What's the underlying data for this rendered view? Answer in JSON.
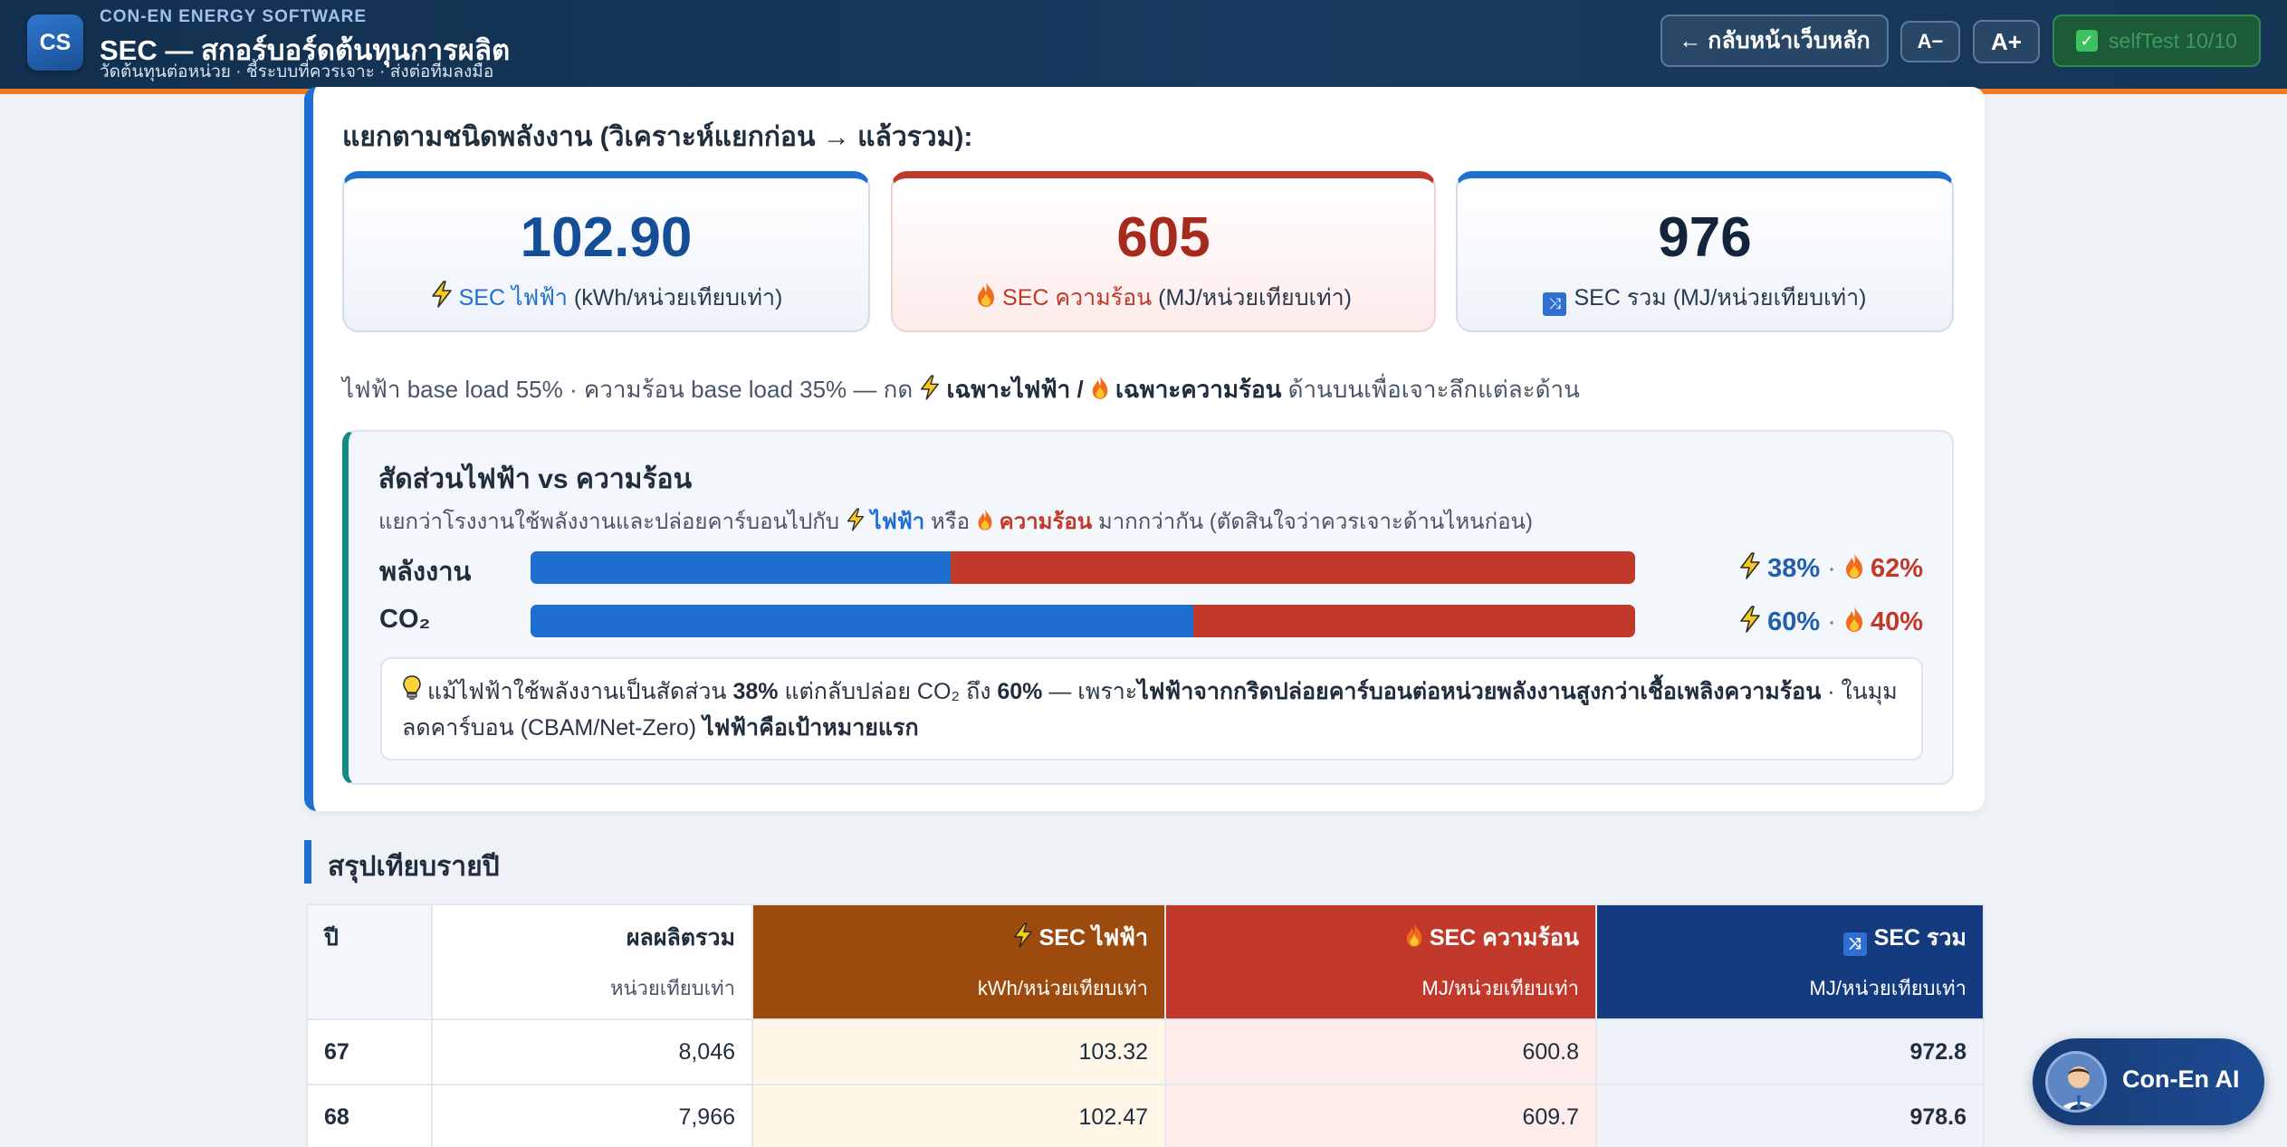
{
  "header": {
    "logo": "CS",
    "brand_small": "CON-EN ENERGY SOFTWARE",
    "title": "SEC — สกอร์บอร์ดต้นทุนการผลิต",
    "subtitle": "วัดต้นทุนต่อหน่วย · ชี้ระบบที่ควรเจาะ · ส่งต่อทีมลงมือ",
    "back_label": "← กลับหน้าเว็บหลัก",
    "font_minus": "A−",
    "font_plus": "A+",
    "selftest_label": "selfTest 10/10"
  },
  "breakdown": {
    "heading": "แยกตามชนิดพลังงาน (วิเคราะห์แยกก่อน → แล้วรวม):",
    "cards": [
      {
        "value": "102.90",
        "key": "SEC ไฟฟ้า",
        "unit": " (kWh/หน่วยเทียบเท่า)",
        "icon": "lightning-icon"
      },
      {
        "value": "605",
        "key": "SEC ความร้อน",
        "unit": " (MJ/หน่วยเทียบเท่า)",
        "icon": "fire-icon"
      },
      {
        "value": "976",
        "key": "SEC รวม",
        "unit": " (MJ/หน่วยเทียบเท่า)",
        "icon": "shuffle-icon"
      }
    ],
    "note_prefix": "ไฟฟ้า base load 55% · ความร้อน base load 35% — กด ",
    "note_elec": "เฉพาะไฟฟ้า",
    "note_sep": " / ",
    "note_heat": "เฉพาะความร้อน",
    "note_suffix": " ด้านบนเพื่อเจาะลึกแต่ละด้าน"
  },
  "ratio": {
    "title": "สัดส่วนไฟฟ้า vs ความร้อน",
    "desc_prefix": "แยกว่าโรงงานใช้พลังงานและปล่อยคาร์บอนไปกับ ",
    "desc_elec": "ไฟฟ้า",
    "desc_or": " หรือ ",
    "desc_heat": "ความร้อน",
    "desc_suffix": " มากกว่ากัน (ตัดสินใจว่าควรเจาะด้านไหนก่อน)",
    "rows": [
      {
        "label": "พลังงาน",
        "elec_pct": 38,
        "heat_pct": 62,
        "elec_text": "38%",
        "heat_text": "62%"
      },
      {
        "label": "CO₂",
        "elec_pct": 60,
        "heat_pct": 40,
        "elec_text": "60%",
        "heat_text": "40%"
      }
    ],
    "insight_1": "แม้ไฟฟ้าใช้พลังงานเป็นสัดส่วน ",
    "insight_2": "38%",
    "insight_3": " แต่กลับปล่อย CO₂ ถึง ",
    "insight_4": "60%",
    "insight_5": " — เพราะ",
    "insight_6": "ไฟฟ้าจากกริดปล่อยคาร์บอนต่อหน่วยพลังงานสูงกว่าเชื้อเพลิงความร้อน",
    "insight_7": " · ในมุมลดคาร์บอน (CBAM/Net-Zero) ",
    "insight_8": "ไฟฟ้าคือเป้าหมายแรก"
  },
  "summary": {
    "title": "สรุปเทียบรายปี",
    "columns": [
      {
        "label": "ปี",
        "sub": ""
      },
      {
        "label": "ผลผลิตรวม",
        "sub": "หน่วยเทียบเท่า"
      },
      {
        "label": "SEC ไฟฟ้า",
        "sub": "kWh/หน่วยเทียบเท่า"
      },
      {
        "label": "SEC ความร้อน",
        "sub": "MJ/หน่วยเทียบเท่า"
      },
      {
        "label": "SEC รวม",
        "sub": "MJ/หน่วยเทียบเท่า"
      }
    ],
    "rows": [
      {
        "year": "67",
        "production": "8,046",
        "sec_elec": "103.32",
        "sec_heat": "600.8",
        "sec_total": "972.8"
      },
      {
        "year": "68",
        "production": "7,966",
        "sec_elec": "102.47",
        "sec_heat": "609.7",
        "sec_total": "978.6"
      }
    ]
  },
  "assistant": {
    "label": "Con-En AI"
  },
  "colors": {
    "electric": "#1f6fd1",
    "heat": "#c0392b",
    "accent": "#f07c1e",
    "header": "#12304f"
  }
}
